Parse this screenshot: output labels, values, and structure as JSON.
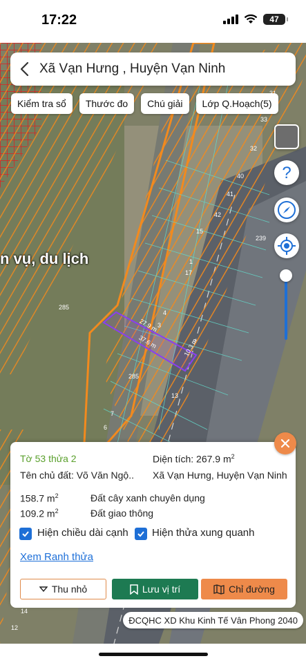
{
  "status": {
    "time": "17:22",
    "battery": "47"
  },
  "search": {
    "title": "Xã Vạn Hưng , Huyện Vạn Ninh"
  },
  "chips": [
    "Kiểm tra sổ",
    "Thước đo",
    "Chú giải",
    "Lớp Q.Hoạch(5)"
  ],
  "map": {
    "area_label": "n vụ, du lịch",
    "parcel_numbers": [
      "31",
      "33",
      "32",
      "40",
      "41",
      "42",
      "15",
      "239",
      "1",
      "17",
      "285",
      "4",
      "3",
      "285",
      "13",
      "7",
      "6",
      "14",
      "12"
    ],
    "edge_labels": [
      "27.9 m",
      "37.6 m",
      "10.3 m"
    ]
  },
  "panel": {
    "parcel_id": "Tờ 53 thửa 2",
    "area_label": "Diện tích: 267.9 m",
    "area_sup": "2",
    "owner": "Tên chủ đất: Võ Văn Ngộ..",
    "location": "Xã Vạn Hưng, Huyện Vạn Ninh",
    "usage": [
      {
        "area": "158.7 m",
        "sup": "2",
        "type": "Đất cây xanh chuyên dụng"
      },
      {
        "area": "109.2 m",
        "sup": "2",
        "type": "Đất giao thông"
      }
    ],
    "check_edges": "Hiện chiều dài cạnh",
    "check_neighbors": "Hiện thửa xung quanh",
    "view_boundary": "Xem Ranh thửa",
    "btn_minimize": "Thu nhỏ",
    "btn_save": "Lưu vị trí",
    "btn_directions": "Chỉ đường"
  },
  "footer": {
    "source": "ĐCQHC XD Khu Kinh Tế Vân Phong 2040"
  },
  "colors": {
    "accent_orange": "#ee8a4a",
    "accent_green": "#1d7a52",
    "link_blue": "#1d6fd8",
    "parcel_green": "#5aa02c"
  }
}
